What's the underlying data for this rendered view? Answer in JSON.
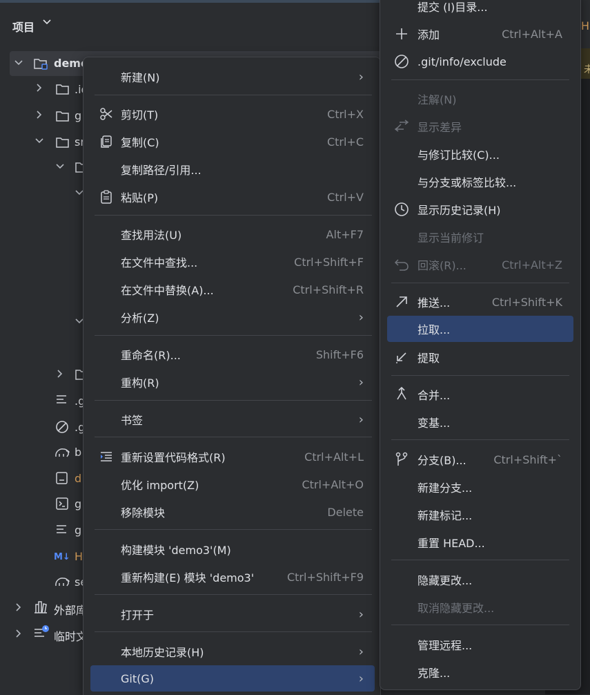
{
  "project_panel": {
    "title": "项目",
    "root": "demo",
    "tree": [
      {
        "label": ".id"
      },
      {
        "label": "g"
      },
      {
        "label": "sr"
      },
      {
        "label": ""
      },
      {
        "label": ".g"
      },
      {
        "label": ".g"
      },
      {
        "label": "b"
      },
      {
        "label": "d"
      },
      {
        "label": "g"
      },
      {
        "label": "g"
      },
      {
        "label": "H"
      },
      {
        "label": "se"
      },
      {
        "label": "外部库"
      },
      {
        "label": "临时文"
      }
    ]
  },
  "editor": {
    "tab_label": "H",
    "banner_text": "未"
  },
  "context_menu": {
    "items": [
      {
        "label": "新建(N)",
        "mnemonic": "N",
        "submenu": true
      },
      {
        "label": "剪切(T)",
        "shortcut": "Ctrl+X",
        "icon": "scissors-icon"
      },
      {
        "label": "复制(C)",
        "shortcut": "Ctrl+C",
        "icon": "copy-icon"
      },
      {
        "label": "复制路径/引用..."
      },
      {
        "label": "粘贴(P)",
        "shortcut": "Ctrl+V",
        "icon": "clipboard-icon"
      },
      {
        "label": "查找用法(U)",
        "shortcut": "Alt+F7"
      },
      {
        "label": "在文件中查找...",
        "shortcut": "Ctrl+Shift+F"
      },
      {
        "label": "在文件中替换(A)...",
        "shortcut": "Ctrl+Shift+R"
      },
      {
        "label": "分析(Z)",
        "submenu": true
      },
      {
        "label": "重命名(R)...",
        "shortcut": "Shift+F6"
      },
      {
        "label": "重构(R)",
        "submenu": true
      },
      {
        "label": "书签",
        "submenu": true
      },
      {
        "label": "重新设置代码格式(R)",
        "shortcut": "Ctrl+Alt+L",
        "icon": "format-icon"
      },
      {
        "label": "优化 import(Z)",
        "shortcut": "Ctrl+Alt+O"
      },
      {
        "label": "移除模块",
        "shortcut": "Delete"
      },
      {
        "label": "构建模块 'demo3'(M)"
      },
      {
        "label": "重新构建(E) 模块 'demo3'",
        "shortcut": "Ctrl+Shift+F9"
      },
      {
        "label": "打开于",
        "submenu": true
      },
      {
        "label": "本地历史记录(H)",
        "submenu": true
      },
      {
        "label": "Git(G)",
        "submenu": true,
        "highlighted": true
      }
    ]
  },
  "git_submenu": {
    "items": [
      {
        "label": "提交 (I)目录..."
      },
      {
        "label": "添加",
        "shortcut": "Ctrl+Alt+A",
        "icon": "plus-icon"
      },
      {
        "label": ".git/info/exclude",
        "icon": "forbidden-icon"
      },
      {
        "label": "注解(N)",
        "disabled": true
      },
      {
        "label": "显示差异",
        "disabled": true,
        "icon": "diff-arrows-icon"
      },
      {
        "label": "与修订比较(C)..."
      },
      {
        "label": "与分支或标签比较..."
      },
      {
        "label": "显示历史记录(H)",
        "icon": "clock-icon"
      },
      {
        "label": "显示当前修订",
        "disabled": true
      },
      {
        "label": "回滚(R)...",
        "shortcut": "Ctrl+Alt+Z",
        "disabled": true,
        "icon": "undo-icon"
      },
      {
        "label": "推送...",
        "shortcut": "Ctrl+Shift+K",
        "icon": "push-arrow-icon"
      },
      {
        "label": "拉取...",
        "highlighted": true
      },
      {
        "label": "提取",
        "icon": "fetch-arrow-icon"
      },
      {
        "label": "合并...",
        "icon": "merge-icon"
      },
      {
        "label": "变基..."
      },
      {
        "label": "分支(B)...",
        "shortcut": "Ctrl+Shift+`",
        "icon": "branch-icon"
      },
      {
        "label": "新建分支..."
      },
      {
        "label": "新建标记..."
      },
      {
        "label": "重置 HEAD..."
      },
      {
        "label": "隐藏更改..."
      },
      {
        "label": "取消隐藏更改...",
        "disabled": true
      },
      {
        "label": "管理远程..."
      },
      {
        "label": "克隆..."
      }
    ]
  },
  "colors": {
    "background": "#2b2d30",
    "highlight": "#2e436e",
    "separator": "#43454a",
    "text": "#dfe1e5",
    "shortcut_text": "#8c8f94",
    "disabled_text": "#6f737a"
  }
}
